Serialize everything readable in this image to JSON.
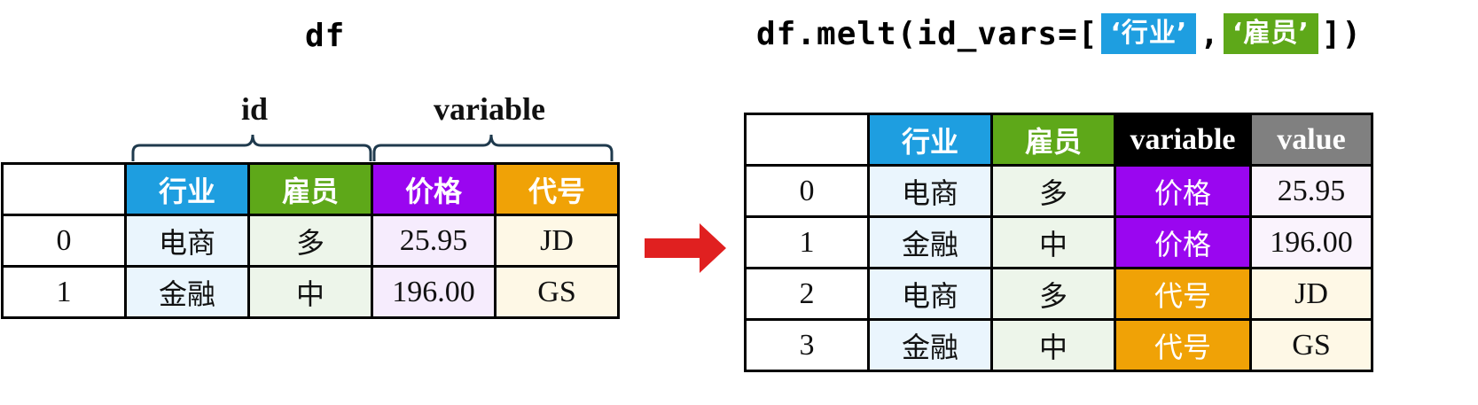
{
  "colors": {
    "hangye": "#1e9ee0",
    "guyuan": "#5ea819",
    "jiage": "#9a06f0",
    "daihao": "#f0a206",
    "variable_header": "#000000",
    "value_header": "#808080",
    "hangye_cell": "#eaf5fd",
    "guyuan_cell": "#edf5ea",
    "jiage_cell": "#f6ecfd",
    "daihao_cell": "#fef8e6",
    "value_cell_light": "#faf3fd",
    "value_cell_cream": "#fef8e6",
    "arrow": "#e02020"
  },
  "titles": {
    "left": "df",
    "right_prefix": "df.melt(id_vars=[",
    "right_chip1": "‘行业’",
    "right_comma": ",",
    "right_chip2": "‘雇员’",
    "right_suffix": "])"
  },
  "brace_labels": {
    "id": "id",
    "variable": "variable"
  },
  "left_table": {
    "headers": [
      "",
      "行业",
      "雇员",
      "价格",
      "代号"
    ],
    "rows": [
      [
        "0",
        "电商",
        "多",
        "25.95",
        "JD"
      ],
      [
        "1",
        "金融",
        "中",
        "196.00",
        "GS"
      ]
    ]
  },
  "right_table": {
    "headers": [
      "",
      "行业",
      "雇员",
      "variable",
      "value"
    ],
    "rows": [
      [
        "0",
        "电商",
        "多",
        "价格",
        "25.95"
      ],
      [
        "1",
        "金融",
        "中",
        "价格",
        "196.00"
      ],
      [
        "2",
        "电商",
        "多",
        "代号",
        "JD"
      ],
      [
        "3",
        "金融",
        "中",
        "代号",
        "GS"
      ]
    ]
  }
}
